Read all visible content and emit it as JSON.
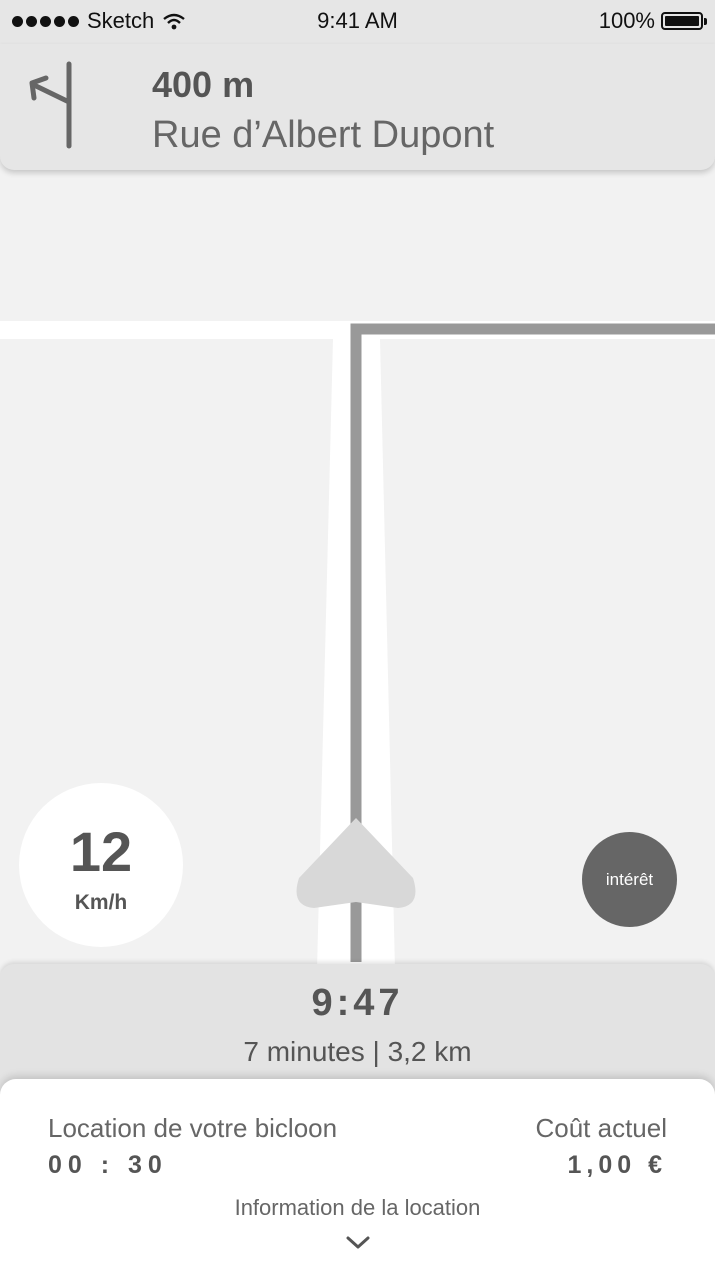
{
  "status_bar": {
    "carrier": "Sketch",
    "time": "9:41 AM",
    "battery_level": "100%",
    "signal_icon": "signal-dots-icon",
    "wifi_icon": "wifi-icon",
    "battery_icon": "battery-icon"
  },
  "navigation": {
    "turn_icon": "turn-left-icon",
    "distance": "400 m",
    "street": "Rue d’Albert Dupont"
  },
  "speed": {
    "value": "12",
    "unit": "Km/h"
  },
  "interest_button": {
    "label": "intérêt"
  },
  "eta": {
    "arrival_time": "9:47",
    "details": "7 minutes | 3,2 km"
  },
  "rental": {
    "label": "Location de votre bicloon",
    "duration": "00 : 30",
    "cost_label": "Coût actuel",
    "cost_value": "1,00 €",
    "info_link": "Information de la location",
    "expand_icon": "chevron-down-icon"
  },
  "colors": {
    "map_background": "#f2f2f2",
    "road": "#ffffff",
    "route": "#999999",
    "panel": "#e6e6e6",
    "interest_button": "#666666",
    "text": "#555555"
  }
}
